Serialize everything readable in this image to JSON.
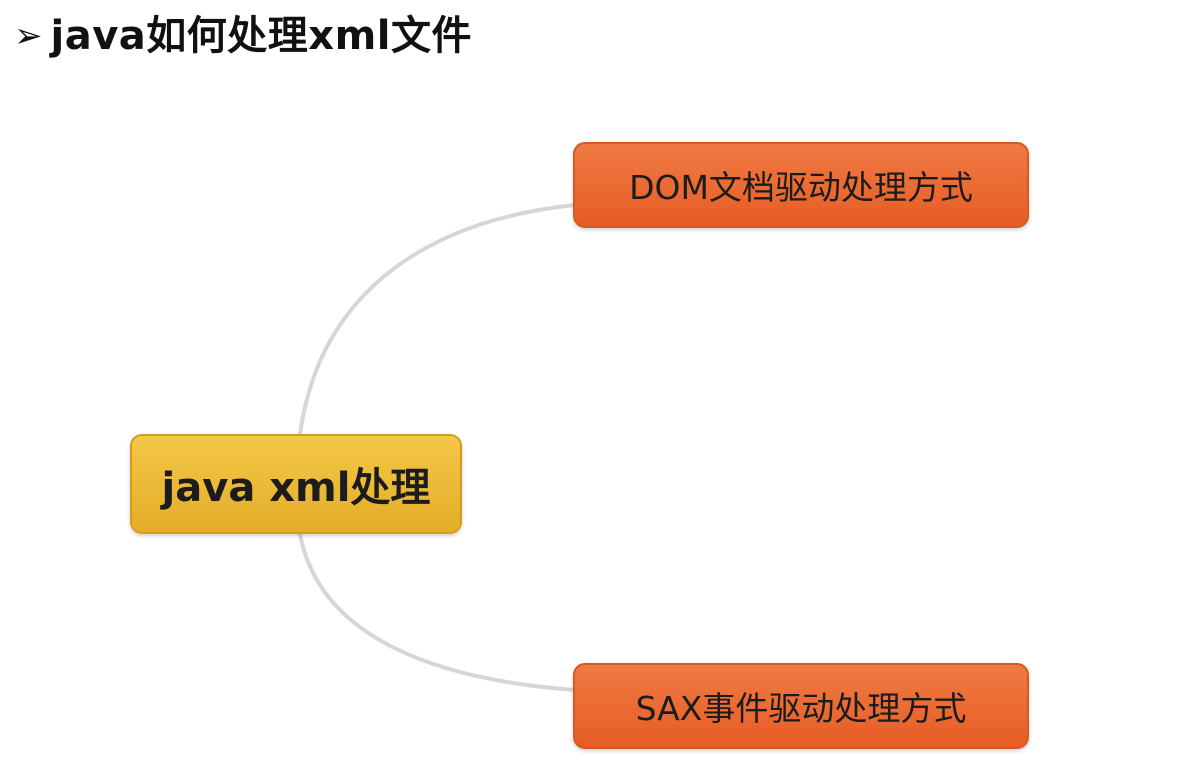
{
  "slide": {
    "bullet_icon": "arrowhead-bullet-icon",
    "bullet_glyph": "➢",
    "title": "java如何处理xml文件"
  },
  "mindmap": {
    "root": {
      "label": "java xml处理",
      "color": "#e8b22f"
    },
    "children": [
      {
        "label": "DOM文档驱动处理方式",
        "color": "#ec6a30"
      },
      {
        "label": "SAX事件驱动处理方式",
        "color": "#ec6a30"
      }
    ],
    "connector_color": "#d6d6d6"
  }
}
